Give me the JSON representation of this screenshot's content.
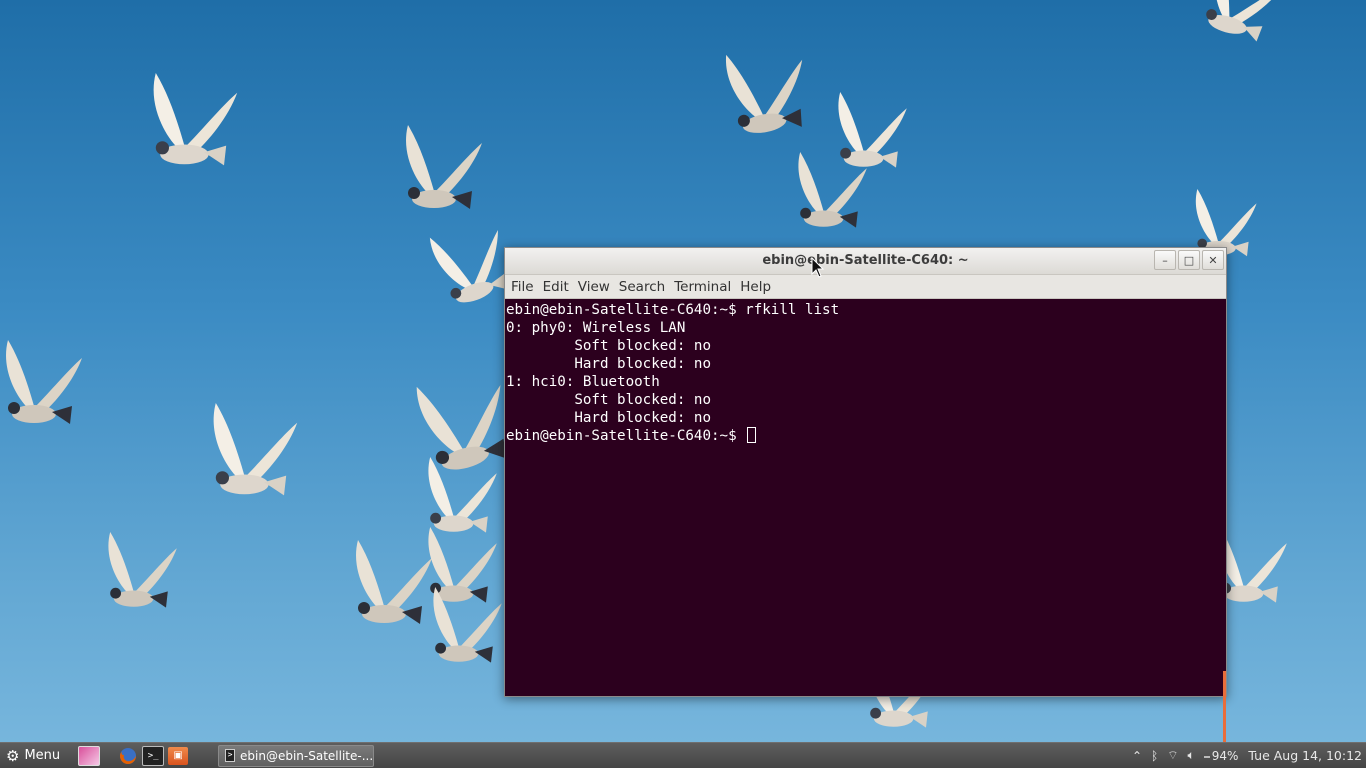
{
  "window": {
    "title": "ebin@ebin-Satellite-C640: ~",
    "buttons": {
      "minimize": "–",
      "maximize": "□",
      "close": "✕"
    },
    "menu": [
      "File",
      "Edit",
      "View",
      "Search",
      "Terminal",
      "Help"
    ]
  },
  "terminal": {
    "lines": [
      "ebin@ebin-Satellite-C640:~$ rfkill list",
      "0: phy0: Wireless LAN",
      "        Soft blocked: no",
      "        Hard blocked: no",
      "1: hci0: Bluetooth",
      "        Soft blocked: no",
      "        Hard blocked: no"
    ],
    "prompt": "ebin@ebin-Satellite-C640:~$ "
  },
  "panel": {
    "menu_label": "Menu",
    "task_label": "ebin@ebin-Satellite-...",
    "battery": "94%",
    "clock": "Tue Aug 14, 10:12"
  },
  "colors": {
    "terminal_bg": "#2c001e",
    "scroll_accent": "#e96d3b",
    "panel_bg": "#505050"
  },
  "icons": [
    "gear-icon",
    "image-viewer-icon",
    "firefox-icon",
    "terminal-icon",
    "files-icon",
    "chevron-up-icon",
    "bluetooth-icon",
    "wifi-icon",
    "volume-icon",
    "battery-icon"
  ]
}
